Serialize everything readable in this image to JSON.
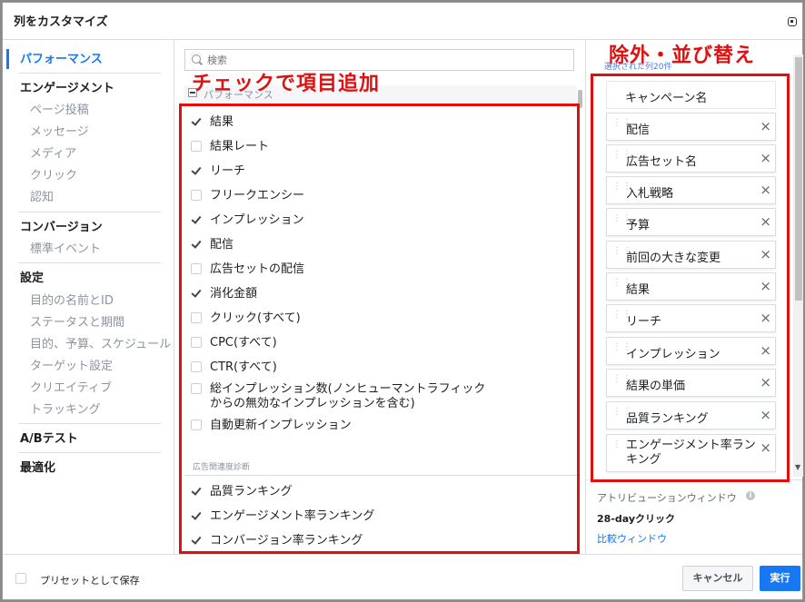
{
  "dialog": {
    "title": "列をカスタマイズ"
  },
  "nav": {
    "items": [
      {
        "label": "パフォーマンス"
      },
      {
        "label": "エンゲージメント"
      },
      {
        "label": "ページ投稿"
      },
      {
        "label": "メッセージ"
      },
      {
        "label": "メディア"
      },
      {
        "label": "クリック"
      },
      {
        "label": "認知"
      },
      {
        "label": "コンバージョン"
      },
      {
        "label": "標準イベント"
      },
      {
        "label": "設定"
      },
      {
        "label": "目的の名前とID"
      },
      {
        "label": "ステータスと期間"
      },
      {
        "label": "目的、予算、スケジュール"
      },
      {
        "label": "ターゲット設定"
      },
      {
        "label": "クリエイティブ"
      },
      {
        "label": "トラッキング"
      },
      {
        "label": "A/Bテスト"
      },
      {
        "label": "最適化"
      }
    ]
  },
  "search": {
    "placeholder": "検索"
  },
  "middle": {
    "section_title": "パフォーマンス",
    "overlay_label": "チェックで項目追加",
    "metrics": [
      {
        "label": "結果",
        "checked": true
      },
      {
        "label": "結果レート",
        "checked": false
      },
      {
        "label": "リーチ",
        "checked": true
      },
      {
        "label": "フリークエンシー",
        "checked": false
      },
      {
        "label": "インプレッション",
        "checked": true
      },
      {
        "label": "配信",
        "checked": true
      },
      {
        "label": "広告セットの配信",
        "checked": false
      },
      {
        "label": "消化金額",
        "checked": true
      },
      {
        "label": "クリック(すべて)",
        "checked": false
      },
      {
        "label": "CPC(すべて)",
        "checked": false
      },
      {
        "label": "CTR(すべて)",
        "checked": false
      },
      {
        "label": "総インプレッション数(ノンヒューマントラフィック",
        "label2": "からの無効なインプレッションを含む)",
        "checked": false
      },
      {
        "label": "自動更新インプレッション",
        "checked": false
      }
    ],
    "group_label": "広告関連度診断",
    "ranking_metrics": [
      {
        "label": "品質ランキング",
        "checked": true
      },
      {
        "label": "エンゲージメント率ランキング",
        "checked": true
      },
      {
        "label": "コンバージョン率ランキング",
        "checked": true
      }
    ]
  },
  "right": {
    "overlay_label": "除外・並び替え",
    "header": "選択された列20件",
    "columns": [
      {
        "label": "キャンペーン名"
      },
      {
        "label": "配信"
      },
      {
        "label": "広告セット名"
      },
      {
        "label": "入札戦略"
      },
      {
        "label": "予算"
      },
      {
        "label": "前回の大きな変更"
      },
      {
        "label": "結果"
      },
      {
        "label": "リーチ"
      },
      {
        "label": "インプレッション"
      },
      {
        "label": "結果の単価"
      },
      {
        "label": "品質ランキング"
      },
      {
        "label": "エンゲージメント率ランキング"
      }
    ],
    "remove_symbol": "×",
    "attribution_label": "アトリビューションウィンドウ",
    "info_symbol": "i",
    "attribution_value": "28-dayクリック",
    "compare_link": "比較ウィンドウ"
  },
  "footer": {
    "preset_label": "プリセットとして保存",
    "cancel_label": "キャンセル",
    "run_label": "実行"
  },
  "colors": {
    "accent": "#1877f2",
    "annotation_red": "#e01010"
  }
}
